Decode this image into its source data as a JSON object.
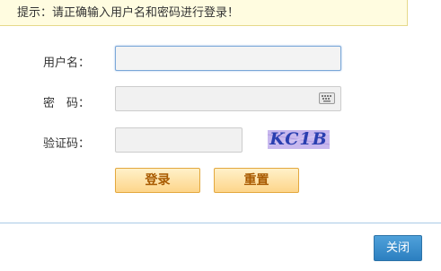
{
  "notice": {
    "text": "提示：请正确输入用户名和密码进行登录！"
  },
  "form": {
    "username_label": "用户名：",
    "username_value": "",
    "password_label": "密　码：",
    "password_value": "",
    "captcha_label": "验证码：",
    "captcha_value": "",
    "captcha_image_text": "KC1B"
  },
  "buttons": {
    "login": "登录",
    "reset": "重置",
    "close": "关闭"
  },
  "colors": {
    "notice_bg": "#fffce0",
    "button_bg": "#fdd58a",
    "button_text": "#a85a00",
    "close_bg": "#3a8ccc",
    "captcha_bg": "#c8b8ee"
  }
}
